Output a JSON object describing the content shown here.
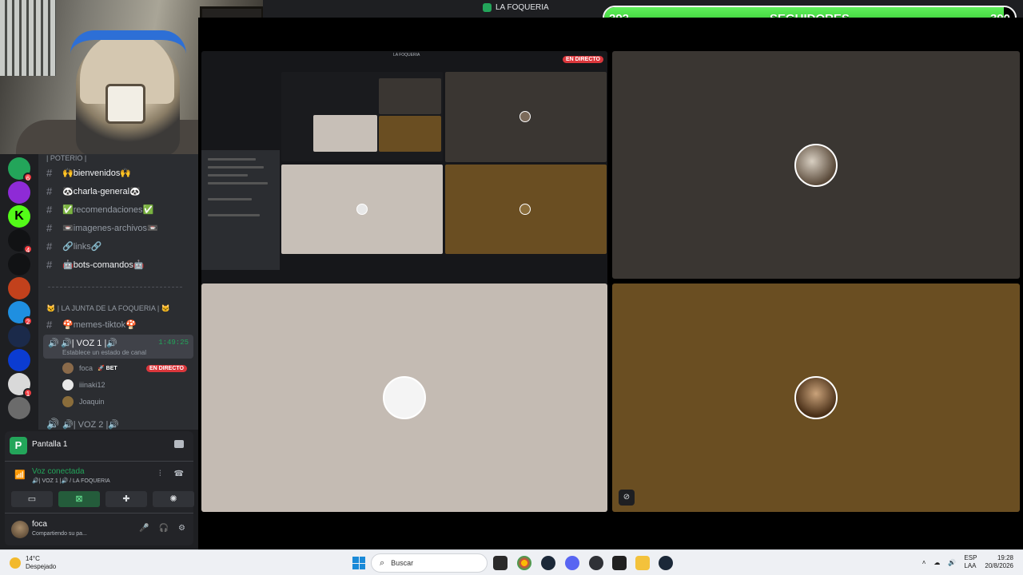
{
  "window": {
    "title": "LA FOQUERIA"
  },
  "followers": {
    "current": "292",
    "label": "SEGUIDORES",
    "goal": "300",
    "progress_fraction": 0.973
  },
  "servers": [
    {
      "color": "#23a55a",
      "badge": "6"
    },
    {
      "color": "#8e2bd6",
      "badge": ""
    },
    {
      "color": "#53fc18",
      "badge": "",
      "letter": "K"
    },
    {
      "color": "#111214",
      "badge": "4"
    },
    {
      "color": "#111214",
      "badge": ""
    },
    {
      "color": "#c2411c",
      "badge": ""
    },
    {
      "color": "#1f8fe0",
      "badge": "2"
    },
    {
      "color": "#1b2a4a",
      "badge": ""
    },
    {
      "color": "#0b3cd1",
      "badge": ""
    },
    {
      "color": "#d9d9d9",
      "badge": "1"
    },
    {
      "color": "#6b6b6b",
      "badge": ""
    }
  ],
  "channels": {
    "top_category": "| POTERIO |",
    "text_channels": [
      {
        "name": "🙌bienvenidos🙌",
        "bright": true
      },
      {
        "name": "🐼charla-general🐼",
        "bright": true
      },
      {
        "name": "✅recomendaciones✅",
        "bright": false
      },
      {
        "name": "📼imagenes-archivos📼",
        "bright": false
      },
      {
        "name": "🔗links🔗",
        "bright": false
      },
      {
        "name": "🤖bots-comandos🤖",
        "bright": true
      }
    ],
    "category2": "🐱 | LA JUNTA DE LA FOQUERIA | 🐱",
    "memes_channel": "🍄memes-tiktok🍄",
    "voice1": {
      "name": "🔊| VOZ 1 |🔊",
      "timer": "1:49:25",
      "status": "Establece un estado de canal"
    },
    "members": [
      {
        "name": "foca",
        "tag": "🚀 BET",
        "live": "EN DIRECTO",
        "avatar_color": "#8a6a4a"
      },
      {
        "name": "iiinaki12",
        "tag": "",
        "live": "",
        "avatar_color": "#e8e8e8"
      },
      {
        "name": "Joaquin",
        "tag": "",
        "live": "",
        "avatar_color": "#8a6d3b"
      }
    ],
    "voice2": "🔊| VOZ 2 |🔊"
  },
  "panel": {
    "screen_label": "Pantalla 1",
    "screen_letter": "P",
    "voice_connected": "Voz conectada",
    "voice_location": "🔊| VOZ 1 |🔊 / LA FOQUERIA",
    "user_name": "foca",
    "user_status": "Compartiendo su pa..."
  },
  "stage": {
    "live_badge": "EN DIRECTO",
    "share_title": "LA FOQUERIA",
    "tiles": {
      "top_right_bg": "#3a3632",
      "bottom_left_bg": "#c4bbb3",
      "bottom_right_bg": "#6a4e22"
    }
  },
  "taskbar": {
    "temperature": "14°C",
    "weather": "Despejado",
    "search_placeholder": "Buscar",
    "language": "ESP",
    "layout": "LAA",
    "time": "19:28",
    "date": "20/8/2026"
  }
}
